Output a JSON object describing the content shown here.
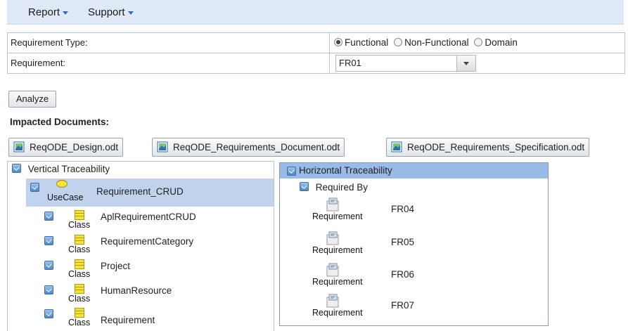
{
  "menu": {
    "report": "Report",
    "support": "Support"
  },
  "form": {
    "type_label": "Requirement Type:",
    "radio_functional": "Functional",
    "radio_nonfunctional": "Non-Functional",
    "radio_domain": "Domain",
    "req_label": "Requirement:",
    "req_value": "FR01"
  },
  "analyze_label": "Analyze",
  "impacted_title": "Impacted Documents:",
  "documents": [
    "ReqODE_Design.odt",
    "ReqODE_Requirements_Document.odt",
    "ReqODE_Requirements_Specification.odt"
  ],
  "vertical": {
    "title": "Vertical Traceability",
    "root": {
      "type": "UseCase",
      "name": "Requirement_CRUD"
    },
    "classes": [
      {
        "type": "Class",
        "name": "AplRequirementCRUD"
      },
      {
        "type": "Class",
        "name": "RequirementCategory"
      },
      {
        "type": "Class",
        "name": "Project"
      },
      {
        "type": "Class",
        "name": "HumanResource"
      },
      {
        "type": "Class",
        "name": "Requirement"
      }
    ]
  },
  "horizontal": {
    "title": "Horizontal Traceability",
    "required_by": "Required By",
    "items": [
      {
        "type": "Requirement",
        "name": "FR04"
      },
      {
        "type": "Requirement",
        "name": "FR05"
      },
      {
        "type": "Requirement",
        "name": "FR06"
      },
      {
        "type": "Requirement",
        "name": "FR07"
      }
    ]
  },
  "colors": {
    "menubar": "#dfe8f6",
    "selected": "#c1d3ec",
    "header": "#99bbe8",
    "class_icon": "#f4e33a"
  },
  "icons": [
    "caret-down-icon",
    "radio-icon",
    "dropdown-arrow-icon",
    "document-icon",
    "expand-toggle-icon",
    "usecase-icon",
    "class-icon",
    "requirement-icon"
  ]
}
